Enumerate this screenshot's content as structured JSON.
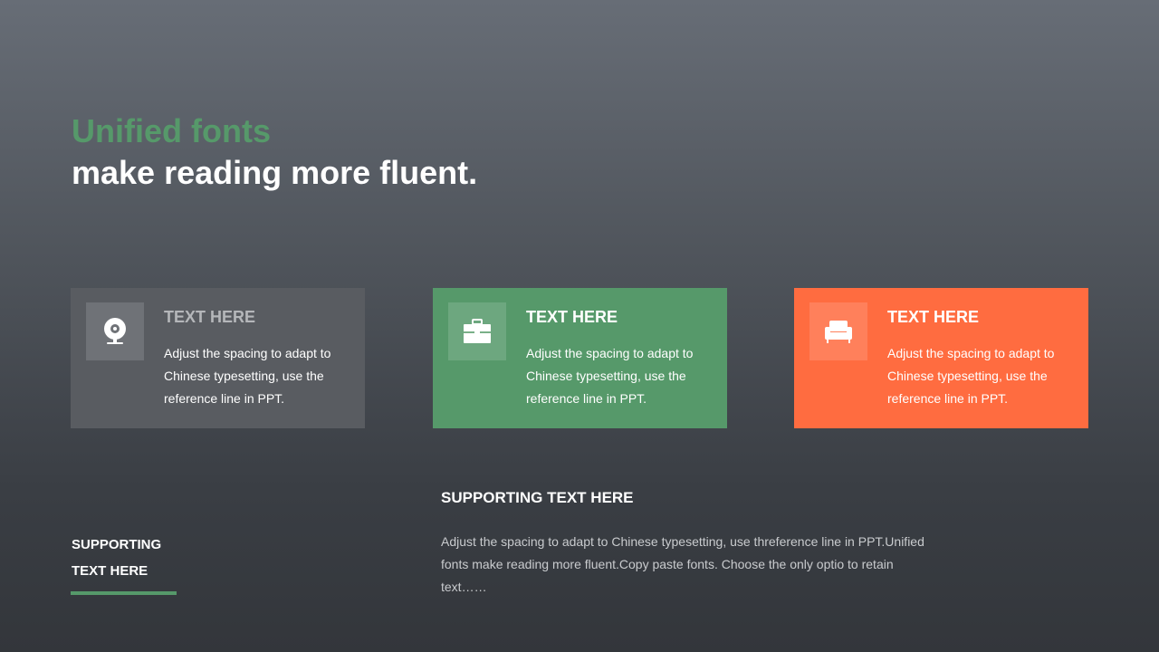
{
  "title": {
    "line1": "Unified fonts",
    "line2": "make reading more fluent."
  },
  "cards": [
    {
      "title": "TEXT HERE",
      "description": "Adjust the spacing to adapt to Chinese typesetting, use the reference line in PPT.",
      "icon": "webcam-icon",
      "color": "#595c61"
    },
    {
      "title": "TEXT HERE",
      "description": "Adjust the spacing to adapt to Chinese typesetting, use the reference line in PPT.",
      "icon": "toolbox-icon",
      "color": "#56996a"
    },
    {
      "title": "TEXT HERE",
      "description": "Adjust the spacing to adapt to Chinese typesetting, use the reference line in PPT.",
      "icon": "armchair-icon",
      "color": "#ff6c40"
    }
  ],
  "support_left": {
    "line1": "SUPPORTING",
    "line2": "TEXT HERE"
  },
  "support_main": {
    "heading": "SUPPORTING  TEXT HERE",
    "body": "Adjust the spacing to adapt to Chinese typesetting, use threference line in PPT.Unified fonts make reading more fluent.Copy paste fonts. Choose the only optio to retain text……"
  },
  "colors": {
    "accent_green": "#56996a",
    "accent_orange": "#ff6c40",
    "card_gray": "#595c61"
  }
}
